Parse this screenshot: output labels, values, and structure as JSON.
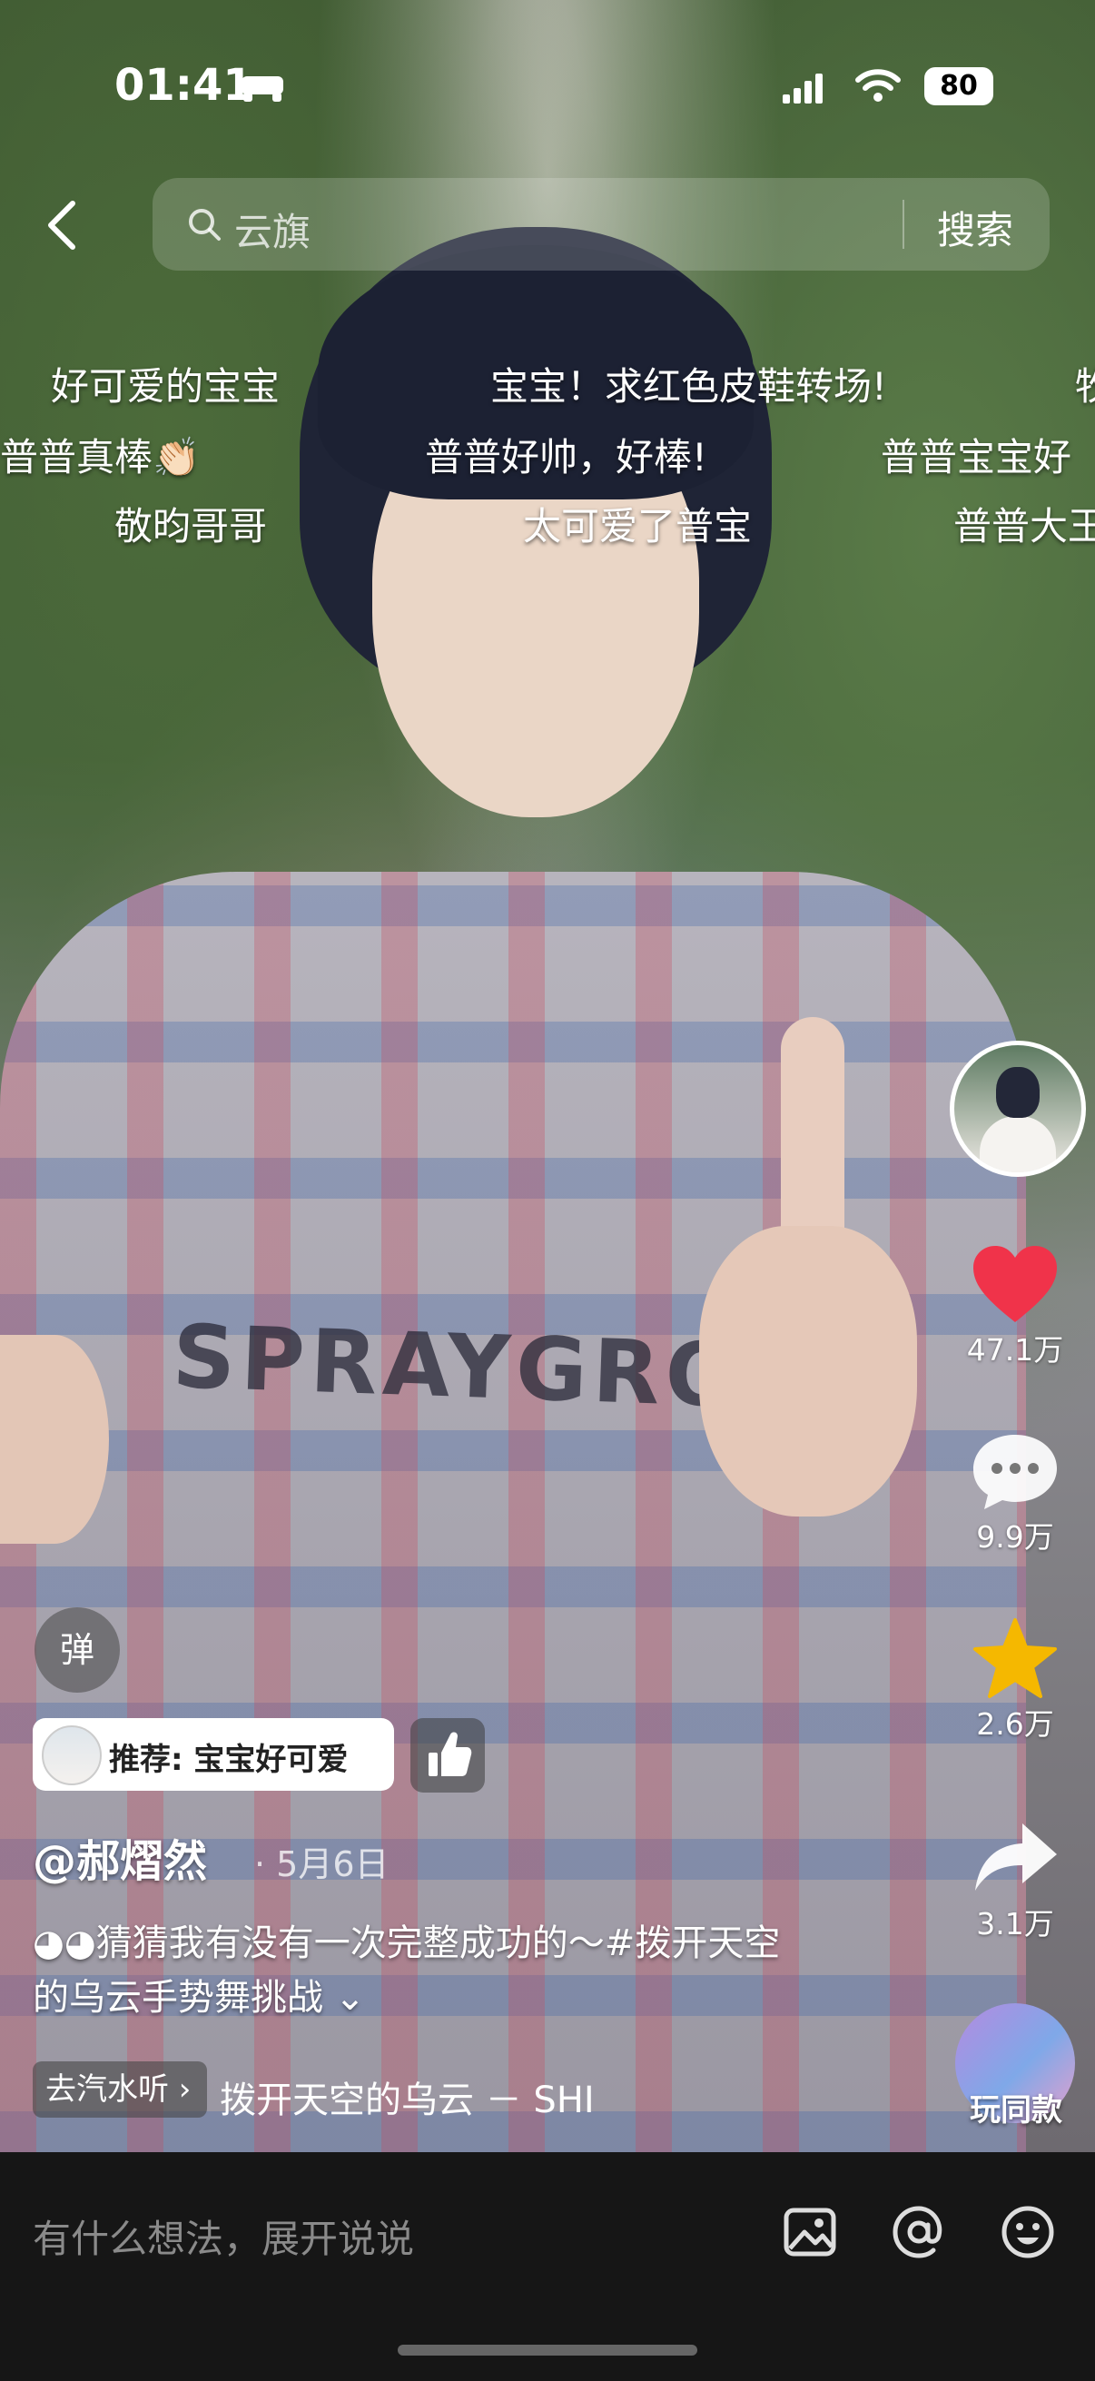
{
  "status_bar": {
    "time": "01:41",
    "battery": "80"
  },
  "search": {
    "placeholder": "云旗",
    "button_label": "搜索"
  },
  "danmaku": [
    "好可爱的宝宝",
    "宝宝！求红色皮鞋转场!",
    "牧",
    "普普真棒👏🏻",
    "普普好帅，好棒!",
    "普普宝宝好",
    "敬昀哥哥",
    "太可爱了普宝",
    "普普大王"
  ],
  "actions": {
    "likes": "47.1万",
    "comments": "9.9万",
    "favorites": "2.6万",
    "shares": "3.1万"
  },
  "danmaku_toggle": "弹",
  "recommend": {
    "text": "推荐: 宝宝好可爱"
  },
  "post": {
    "author": "@郝熠然",
    "date": "· 5月6日",
    "caption_line1": "◕◕猜猜我有没有一次完整成功的～#拨开天空",
    "caption_line2": "的乌云手势舞挑战 ⌄"
  },
  "music": {
    "tag": "去汽水听 ›",
    "name": "拨开天空的乌云 － SHI"
  },
  "same_style_label": "玩同款",
  "comment_bar": {
    "placeholder": "有什么想法，展开说说"
  },
  "colors": {
    "like": "#f0334a",
    "favorite": "#f5b800"
  }
}
